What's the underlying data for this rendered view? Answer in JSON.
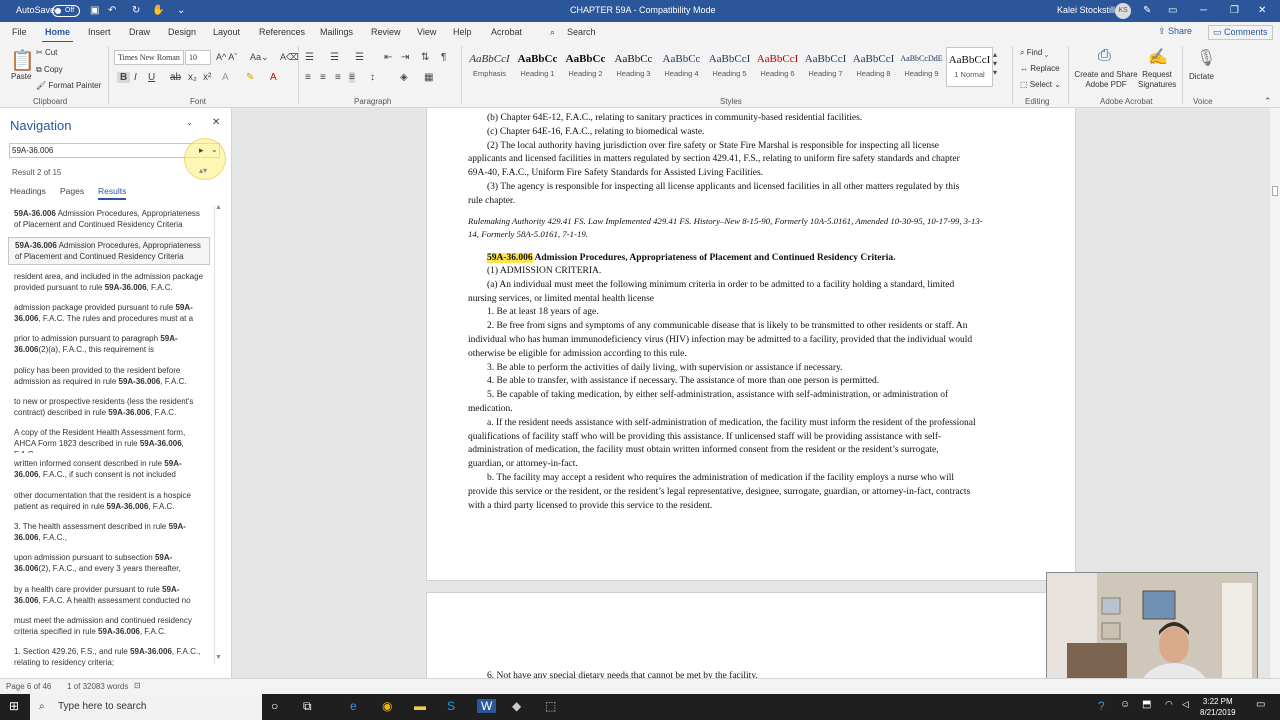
{
  "titlebar": {
    "autosave_label": "AutoSave",
    "autosave_state": "Off",
    "doc_title": "CHAPTER 59A  -  Compatibility Mode",
    "user_name": "Kalei Stockstill",
    "user_initials": "KS"
  },
  "menu": {
    "tabs": [
      "File",
      "Home",
      "Insert",
      "Draw",
      "Design",
      "Layout",
      "References",
      "Mailings",
      "Review",
      "View",
      "Help",
      "Acrobat"
    ],
    "active": "Home",
    "search": "Search",
    "share": "Share",
    "comments": "Comments"
  },
  "ribbon": {
    "clipboard": {
      "paste": "Paste",
      "cut": "Cut",
      "copy": "Copy",
      "format_painter": "Format Painter",
      "label": "Clipboard"
    },
    "font": {
      "name": "Times New Roman",
      "size": "10",
      "label": "Font"
    },
    "paragraph": {
      "label": "Paragraph"
    },
    "styles": {
      "label": "Styles",
      "items": [
        {
          "preview": "AaBbCcI",
          "name": "Emphasis"
        },
        {
          "preview": "AaBbCc",
          "name": "Heading 1"
        },
        {
          "preview": "AaBbCc",
          "name": "Heading 2"
        },
        {
          "preview": "AaBbCc",
          "name": "Heading 3"
        },
        {
          "preview": "AaBbCc",
          "name": "Heading 4"
        },
        {
          "preview": "AaBbCcI",
          "name": "Heading 5"
        },
        {
          "preview": "AaBbCcI",
          "name": "Heading 6"
        },
        {
          "preview": "AaBbCcI",
          "name": "Heading 7"
        },
        {
          "preview": "AaBbCcI",
          "name": "Heading 8"
        },
        {
          "preview": "AaBbCcDdE",
          "name": "Heading 9"
        },
        {
          "preview": "AaBbCcI",
          "name": "1 Normal"
        }
      ]
    },
    "editing": {
      "find": "Find",
      "replace": "Replace",
      "select": "Select",
      "label": "Editing"
    },
    "acrobat": {
      "create": "Create and Share Adobe PDF",
      "request": "Request Signatures",
      "label": "Adobe Acrobat"
    },
    "voice": {
      "dictate": "Dictate",
      "label": "Voice"
    }
  },
  "nav": {
    "title": "Navigation",
    "search_value": "59A-36.006",
    "result_count": "Result 2 of 15",
    "tabs": [
      "Headings",
      "Pages",
      "Results"
    ],
    "active_tab": "Results",
    "results": [
      [
        "",
        "59A-36.006",
        " Admission Procedures, Appropriateness of Placement and Continued Residency Criteria",
        ""
      ],
      [
        "",
        "59A-36.006",
        " Admission Procedures, Appropriateness of Placement and Continued Residency Criteria",
        ""
      ],
      [
        "resident area, and included in the admission package provided pursuant to rule ",
        "59A-36.006",
        ", F.A.C.",
        ""
      ],
      [
        "admission package provided pursuant to rule ",
        "59A-36.006",
        ", F.A.C. The rules and procedures must at a",
        ""
      ],
      [
        "prior to admission pursuant to paragraph ",
        "59A-36.006",
        "(2)(a), F.A.C., this requirement is",
        ""
      ],
      [
        "policy has been provided to the resident before admission as required in rule ",
        "59A-36.006",
        ", F.A.C.",
        ""
      ],
      [
        "to new or prospective residents (less the resident's contract) described in rule ",
        "59A-36.006",
        ", F.A.C.",
        ""
      ],
      [
        "A copy of the Resident Health Assessment form, AHCA Form 1823 described in rule ",
        "59A-36.006",
        ", F.A.C.",
        ""
      ],
      [
        "written informed consent described in rule ",
        "59A-36.006",
        ", F.A.C., if such consent is not included",
        ""
      ],
      [
        "other documentation that the resident is a hospice patient as required in rule ",
        "59A-36.006",
        ", F.A.C.",
        ""
      ],
      [
        "3. The health assessment described in rule ",
        "59A-36.006",
        ", F.A.C.,",
        ""
      ],
      [
        "upon admission pursuant to subsection ",
        "59A-36.006",
        "(2), F.A.C., and every 3 years thereafter,",
        ""
      ],
      [
        "by a health care provider pursuant to rule ",
        "59A-36.006",
        ", F.A.C. A health assessment conducted no",
        ""
      ],
      [
        "must meet the admission and continued residency criteria specified in rule ",
        "59A-36.006",
        ", F.A.C.",
        ""
      ],
      [
        "1. Section 429.26, F.S., and rule ",
        "59A-36.006",
        ", F.A.C., relating to residency criteria;",
        ""
      ]
    ]
  },
  "doc": {
    "lines": [
      "(b) Chapter 64E-12, F.A.C., relating to sanitary practices in community-based residential facilities.",
      "(c) Chapter 64E-16, F.A.C., relating to biomedical waste.",
      "(2) The local authority having jurisdiction over fire safety or State Fire Marshal is responsible for inspecting all license",
      "applicants and licensed facilities in matters regulated by section 429.41, F.S., relating to uniform fire safety standards and chapter",
      "69A-40, F.A.C., Uniform Fire Safety Standards for Assisted Living Facilities.",
      "(3) The agency is responsible for inspecting all license applicants and licensed facilities in all other matters regulated by this",
      "rule chapter."
    ],
    "authority": [
      "Rulemaking Authority 429.41 FS. Law Implemented 429.41 FS. History–New 8-15-90, Formerly 10A-5.0161, Amended 10-30-95, 10-17-99, 3-13-",
      "14, Formerly 58A-5.0161, 7-1-19."
    ],
    "heading_code": "59A-36.006",
    "heading_text": " Admission Procedures, Appropriateness of Placement and Continued Residency Criteria.",
    "body": [
      "(1) ADMISSION CRITERIA.",
      "(a) An individual must meet the following minimum criteria in order to be admitted to a facility holding a standard, limited",
      "nursing services, or limited mental health license",
      "1. Be at least 18 years of age.",
      "2. Be free from signs and symptoms of any communicable disease that is likely to be transmitted to other residents or staff. An",
      "individual who has human immunodeficiency virus (HIV) infection may be admitted to a facility, provided that the individual would",
      "otherwise be eligible for admission according to this rule.",
      "3. Be able to perform the activities of daily living, with supervision or assistance if necessary.",
      "4. Be able to transfer, with assistance if necessary. The assistance of more than one person is permitted.",
      "5. Be capable of taking medication, by either self-administration, assistance with self-administration, or administration of",
      "medication.",
      "a. If the resident needs assistance with self-administration of medication, the facility must inform the resident of the professional",
      "qualifications of facility staff who will be providing this assistance. If unlicensed staff will be providing assistance with self-",
      "administration of medication, the facility must obtain written informed consent from the resident or the resident’s surrogate,",
      "guardian, or attorney-in-fact.",
      "b. The facility may accept a resident who requires the administration of medication if the facility employs a nurse who will",
      "provide this service or the resident, or the resident’s legal representative, designee, surrogate, guardian, or attorney-in-fact, contracts",
      "with a third party licensed to provide this service to the resident."
    ],
    "page2_line": "6. Not have any special dietary needs that cannot be met by the facility."
  },
  "status": {
    "page": "Page 6 of 46",
    "words": "1 of 32083 words"
  },
  "taskbar": {
    "search_placeholder": "Type here to search",
    "time": "3:22 PM",
    "date": "8/21/2019"
  }
}
